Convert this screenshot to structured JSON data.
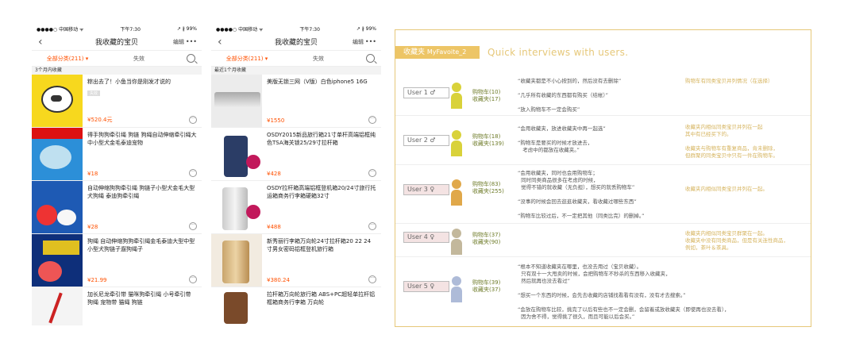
{
  "phones": [
    {
      "status": {
        "carrier": "●●●●○ 中国移动 ᯤ",
        "time": "下午7:30",
        "battery": "↗ ∦ 99%"
      },
      "nav": {
        "title": "我收藏的宝贝",
        "edit": "编辑",
        "more": "•••"
      },
      "tabs": {
        "all": "全部分类(211) ▾",
        "invalid": "失效"
      },
      "section": "3个月内收藏",
      "items": [
        {
          "title": "粽出去了！小鱼当你是刚发才说的",
          "tag": "失效",
          "price": "¥520.4元"
        },
        {
          "title": "得手狗狗牵引绳 狗链 狗绳自动伸缩牵引绳大中小型犬金毛泰迪宠物",
          "price": "¥18"
        },
        {
          "title": "自动伸缩狗狗牵引绳 狗链子小型犬金毛大型犬狗绳 泰迪狗牵引绳",
          "price": "¥28"
        },
        {
          "title": "狗绳 自动伸缩狗狗牵引绳金毛泰迪大型中型小型犬狗链子遛狗绳子",
          "price": "¥21.99"
        },
        {
          "title": "加长尼龙牵引带 猫咪狗牵引绳 小号牵引带 狗绳 宠物带 猫绳 狗链"
        }
      ]
    },
    {
      "status": {
        "carrier": "●●●●○ 中国移动 ᯤ",
        "time": "下午7:30",
        "battery": "↗ ∦ 99%"
      },
      "nav": {
        "title": "我收藏的宝贝",
        "edit": "编辑",
        "more": "•••"
      },
      "tabs": {
        "all": "全部分类(211) ▾",
        "invalid": "失效"
      },
      "section": "最近1个月收藏",
      "items": [
        {
          "title": "美版无锁三网（V版）白色iphone5 16G",
          "price": "¥1550"
        },
        {
          "title": "OSDY2015新品旅行箱21寸单杆高端铝框纯色TSA海关锁25/29寸拉杆箱",
          "price": "¥428"
        },
        {
          "title": "OSDY拉杆箱高端铝框登机箱20/24寸旅行托运箱商务行李箱硬箱32寸",
          "price": "¥488"
        },
        {
          "title": "新秀丽行李箱万向轮24寸拉杆箱20 22 24寸男女密码铝框登机旅行箱",
          "price": "¥380.24"
        },
        {
          "title": "拉杆箱万向轮旅行箱 ABS+PC超轻单拉杆铝框箱商务行李箱 万向轮"
        }
      ]
    }
  ],
  "panel": {
    "label": "收藏夹",
    "label_en": "MyFavoite_2",
    "subtitle": "Quick interviews with users.",
    "users": [
      {
        "name": "User 1",
        "sym": "♂",
        "color": "#d9d23a",
        "cnt1": "购物车(10)",
        "cnt2": "收藏夹(17)",
        "quotes": "“收藏夹都是不小心按到的，然后没有去删除”\n\n“几乎所有收藏的东西都有购买（结帐）”\n\n“放入购物车不一定会购买”",
        "note": "购物车有同类宝贝并列情况（在选择）"
      },
      {
        "name": "User 2",
        "sym": "♂",
        "color": "#d9d23a",
        "cnt1": "购物车(18)",
        "cnt2": "收藏夹(139)",
        "quotes": "“会用收藏夹，放进收藏夹中再一起选”\n\n“购物车是要买的时候才放进去，\n   考虑中的都放在收藏夹。”",
        "note": "收藏夹内相似同类宝贝并列在一起\n其中有已经买下的。\n\n收藏夹与购物车有重复商品，肯未删除，\n但群聚的同类宝贝中只有一件在购物车。"
      },
      {
        "name": "User 3",
        "sym": "♀",
        "color": "#e0a84a",
        "cnt1": "购物车(83)",
        "cnt2": "收藏夹(255)",
        "quotes": "“会用收藏夹，同时也会用购物车；\n  同时同类商品很多在考虑的时候，\n  觉得不错的就收藏（无负担），想买的就丢购物车”\n\n“没事的时候会回去逛逛收藏夹，看收藏过哪些东西”\n\n“购物车比较过后，不一定把其他（同类比完）的删掉。”",
        "note": "收藏夹内相似同类宝贝并列在一起。"
      },
      {
        "name": "User 4",
        "sym": "♀",
        "color": "#c3b89c",
        "cnt1": "购物车(37)",
        "cnt2": "收藏夹(90)",
        "quotes": "",
        "note": "收藏夹内相似同类宝贝群聚在一起。\n收藏夹中没有同类商品，但是有关连性商品，\n例如，茶叶＆茶具。"
      },
      {
        "name": "User 5",
        "sym": "♀",
        "color": "#aebbd8",
        "cnt1": "购物车(39)",
        "cnt2": "收藏夹(37)",
        "quotes": "“根本不知道收藏夹在哪里，也没去用过（宝贝收藏）。\n  只有双十一大甩卖的时候，会把购物车不秒杀的东西移入收藏夹，\n  然后就再也没去看过”\n\n“想买一个东西的时候，会先去收藏的店铺找看看有没有，没有才去搜索。”\n\n“会放在购物车比较，挑完了以后有些也不一定会删，会留着或放收藏夹（即使再也没去看），\n  因为舍不得，觉得挑了很久，而且可能以后会买。”",
        "note": ""
      }
    ]
  }
}
